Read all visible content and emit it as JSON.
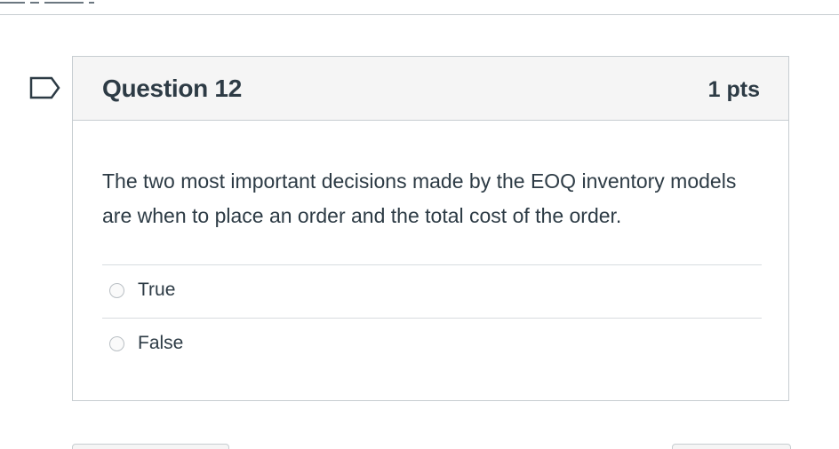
{
  "question": {
    "title": "Question 12",
    "points": "1 pts",
    "text": "The two most important decisions made by the EOQ inventory models are when to place an order and the total cost of the order.",
    "flag_icon": "flag-question-icon"
  },
  "answers": [
    {
      "label": "True",
      "selected": false
    },
    {
      "label": "False",
      "selected": false
    }
  ],
  "colors": {
    "text": "#2d3b45",
    "border": "#c7cdd1",
    "header_bg": "#f5f5f5",
    "flag": "#2d3b45"
  }
}
